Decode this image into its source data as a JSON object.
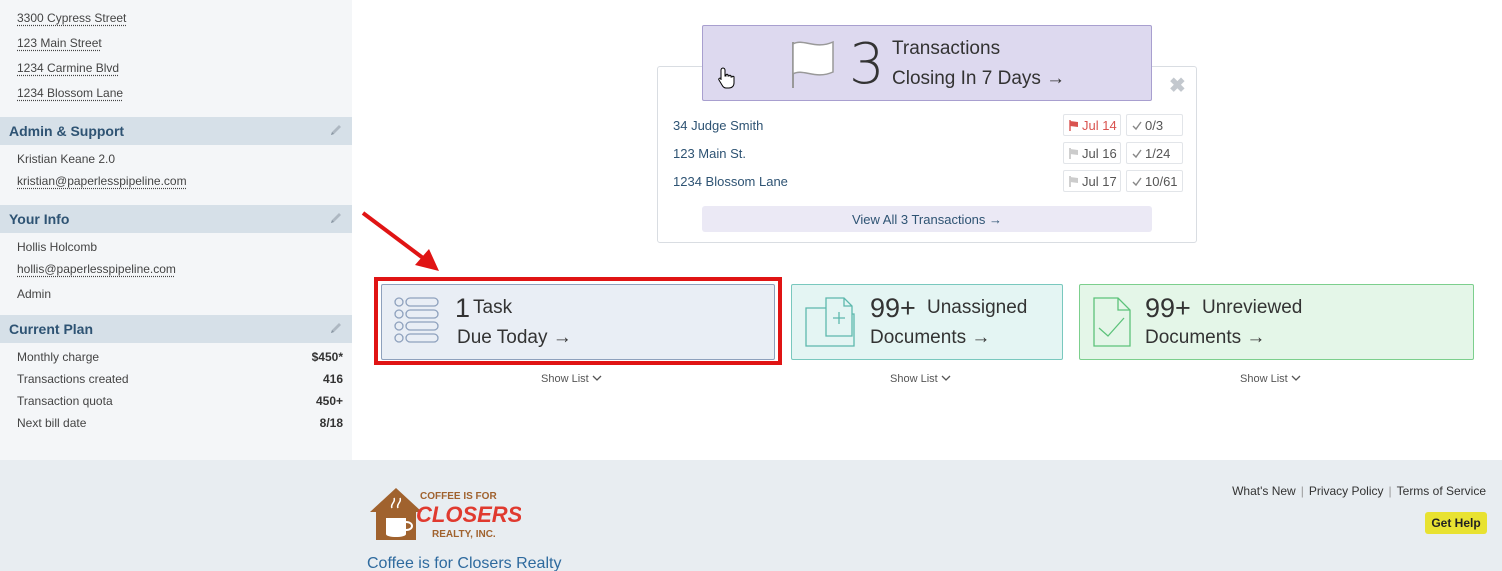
{
  "sidebar": {
    "addresses": [
      "3300 Cypress Street",
      "123 Main Street",
      "1234 Carmine Blvd",
      "1234 Blossom Lane"
    ],
    "admin_support": {
      "title": "Admin & Support",
      "name": "Kristian Keane 2.0",
      "email": "kristian@paperlesspipeline.com"
    },
    "your_info": {
      "title": "Your Info",
      "name": "Hollis Holcomb",
      "email": "hollis@paperlesspipeline.com",
      "role": "Admin"
    },
    "current_plan": {
      "title": "Current Plan",
      "rows": [
        {
          "label": "Monthly charge",
          "value": "$450*"
        },
        {
          "label": "Transactions created",
          "value": "416"
        },
        {
          "label": "Transaction quota",
          "value": "450+"
        },
        {
          "label": "Next bill date",
          "value": "8/18"
        }
      ]
    }
  },
  "transactions": {
    "count": "3",
    "line1": "Transactions",
    "line2": "Closing In 7 Days →",
    "rows": [
      {
        "name": "34 Judge Smith",
        "date": "Jul 14",
        "progress": "0/3",
        "date_color": "#d9534f"
      },
      {
        "name": "123 Main St.",
        "date": "Jul 16",
        "progress": "1/24"
      },
      {
        "name": "1234 Blossom Lane",
        "date": "Jul 17",
        "progress": "10/61"
      }
    ],
    "view_all": "View All 3 Transactions →",
    "close": "✖"
  },
  "cards": {
    "task": {
      "num": "1",
      "l1": "Task",
      "l2": "Due Today →",
      "show_list": "Show List"
    },
    "unassigned": {
      "num": "99+",
      "l1": "Unassigned",
      "l2": "Documents →",
      "show_list": "Show List"
    },
    "unreviewed": {
      "num": "99+",
      "l1": "Unreviewed",
      "l2": "Documents →",
      "show_list": "Show List"
    }
  },
  "footer": {
    "links": [
      "What's New",
      "Privacy Policy",
      "Terms of Service"
    ],
    "get_help": "Get Help",
    "company": "Coffee is for Closers Realty",
    "logo": {
      "line1": "COFFEE IS FOR",
      "line2": "CLOSERS",
      "line3": "REALTY, INC."
    }
  },
  "colors": {
    "accent_red": "#e01414",
    "link_blue": "#2e5373",
    "help_yellow": "#e8e231"
  }
}
